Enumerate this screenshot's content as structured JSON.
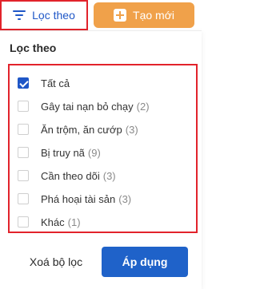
{
  "toolbar": {
    "filter_label": "Lọc theo",
    "create_label": "Tạo mới"
  },
  "panel": {
    "title": "Lọc theo",
    "options": [
      {
        "label": "Tất cả",
        "count": "",
        "checked": true
      },
      {
        "label": "Gây tai nạn bỏ chạy",
        "count": "(2)",
        "checked": false
      },
      {
        "label": "Ăn trộm, ăn cướp",
        "count": "(3)",
        "checked": false
      },
      {
        "label": "Bị truy nã",
        "count": "(9)",
        "checked": false
      },
      {
        "label": "Cần theo dõi",
        "count": "(3)",
        "checked": false
      },
      {
        "label": "Phá hoại tài sản",
        "count": "(3)",
        "checked": false
      },
      {
        "label": "Khác",
        "count": "(1)",
        "checked": false
      }
    ],
    "clear_label": "Xoá bộ lọc",
    "apply_label": "Áp dụng"
  },
  "colors": {
    "accent_blue": "#1f57c7",
    "create_orange": "#f0a14a",
    "highlight_red": "#e2232b"
  },
  "icons": {
    "filter": "filter-lines-icon",
    "create": "plus-square-icon"
  }
}
